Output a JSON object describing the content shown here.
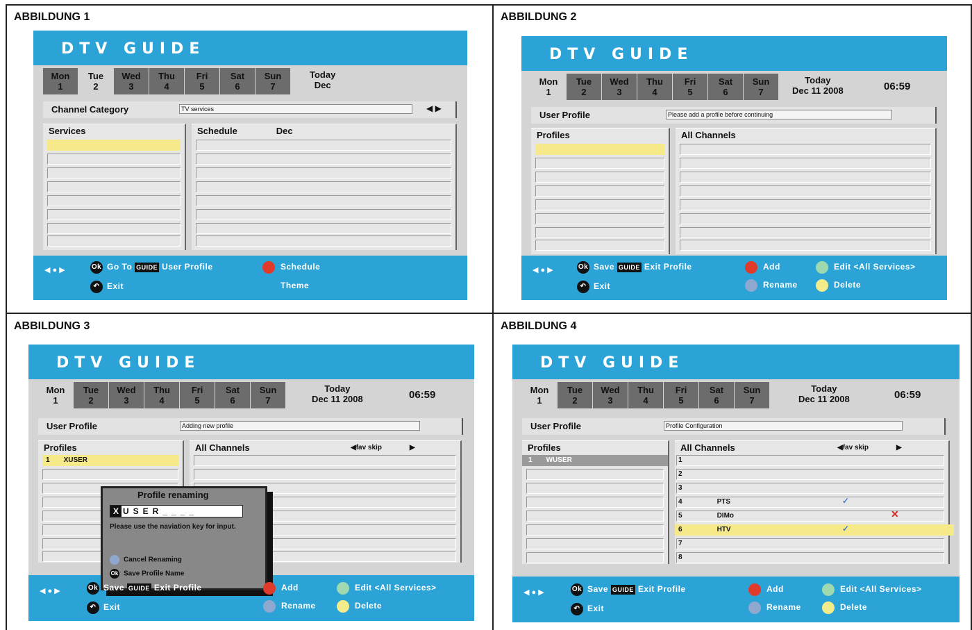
{
  "labels": {
    "fig1": "ABBILDUNG 1",
    "fig2": "ABBILDUNG 2",
    "fig3": "ABBILDUNG 3",
    "fig4": "ABBILDUNG 4"
  },
  "common": {
    "title": "DTV GUIDE",
    "days": [
      {
        "name": "Mon",
        "num": "1"
      },
      {
        "name": "Tue",
        "num": "2"
      },
      {
        "name": "Wed",
        "num": "3"
      },
      {
        "name": "Thu",
        "num": "4"
      },
      {
        "name": "Fri",
        "num": "5"
      },
      {
        "name": "Sat",
        "num": "6"
      },
      {
        "name": "Sun",
        "num": "7"
      }
    ],
    "today": "Today",
    "date": "Dec 11 2008",
    "time": "06:59",
    "ok": "Ok",
    "guide": "GUIDE"
  },
  "fig1": {
    "today_date": "Dec",
    "category_label": "Channel Category",
    "category_value": "TV services",
    "services_header": "Services",
    "schedule_header": "Schedule",
    "schedule_date": "Dec",
    "f_goto": "Go To",
    "f_user_profile": "User Profile",
    "f_schedule": "Schedule",
    "f_exit": "Exit",
    "f_theme": "Theme"
  },
  "fig2": {
    "profile_label": "User Profile",
    "profile_value": "Please add a profile before continuing",
    "profiles_header": "Profiles",
    "channels_header": "All Channels",
    "f_save": "Save",
    "f_exit_profile": "Exit Profile",
    "f_add": "Add",
    "f_edit": "Edit <All Services>",
    "f_exit": "Exit",
    "f_rename": "Rename",
    "f_delete": "Delete"
  },
  "fig3": {
    "profile_label": "User Profile",
    "profile_value": "Adding new profile",
    "profiles_header": "Profiles",
    "channels_header": "All Channels",
    "fav_skip": "fav skip",
    "profile_row_num": "1",
    "profile_row_name": "XUSER",
    "popup_title": "Profile renaming",
    "popup_entry_cursor": "X",
    "popup_entry_text": "USER____",
    "popup_msg": "Please use the naviation key for input.",
    "popup_cancel": "Cancel Renaming",
    "popup_save": "Save Profile Name"
  },
  "fig4": {
    "profile_label": "User Profile",
    "profile_value": "Profile Configuration",
    "profiles_header": "Profiles",
    "channels_header": "All Channels",
    "fav_skip": "fav skip",
    "profile_row_num": "1",
    "profile_row_name": "WUSER",
    "channels": [
      {
        "num": "1",
        "name": ""
      },
      {
        "num": "2",
        "name": ""
      },
      {
        "num": "3",
        "name": ""
      },
      {
        "num": "4",
        "name": "PTS"
      },
      {
        "num": "5",
        "name": "DIMo"
      },
      {
        "num": "6",
        "name": "HTV"
      },
      {
        "num": "7",
        "name": ""
      },
      {
        "num": "8",
        "name": ""
      }
    ]
  },
  "colors": {
    "accent_blue": "#2ba3d6",
    "red": "#e03a2a",
    "green": "#9ed9b0",
    "blue_btn": "#8fa8d0",
    "yellow": "#f4ec8a",
    "highlight": "#f6e98a"
  }
}
